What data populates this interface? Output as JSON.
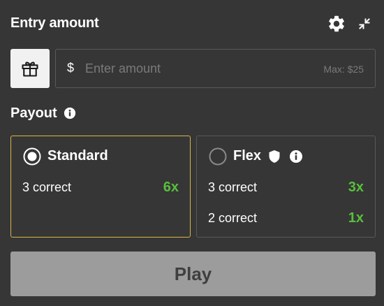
{
  "header": {
    "title": "Entry amount",
    "icons": [
      "gear-icon",
      "collapse-icon"
    ]
  },
  "entry": {
    "currency_symbol": "$",
    "placeholder": "Enter amount",
    "value": "",
    "max_label": "Max: $25",
    "gift_icon": "gift-icon"
  },
  "payout": {
    "title": "Payout",
    "options": [
      {
        "name": "Standard",
        "selected": true,
        "rows": [
          {
            "label": "3 correct",
            "multiplier": "6x"
          }
        ]
      },
      {
        "name": "Flex",
        "selected": false,
        "rows": [
          {
            "label": "3 correct",
            "multiplier": "3x"
          },
          {
            "label": "2 correct",
            "multiplier": "1x"
          }
        ]
      }
    ]
  },
  "play": {
    "label": "Play",
    "enabled": false
  },
  "colors": {
    "background": "#363636",
    "selected_border": "#d8b645",
    "multiplier_green": "#58bf3c",
    "play_disabled_bg": "#9c9c9c"
  }
}
